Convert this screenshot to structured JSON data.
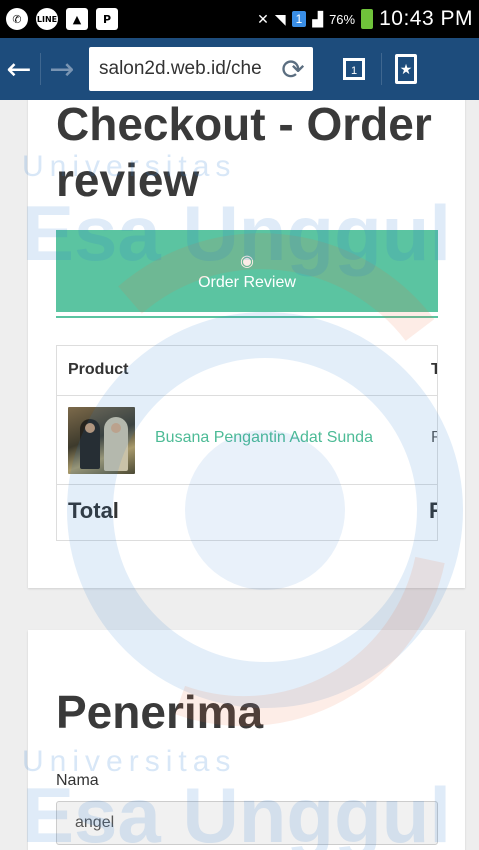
{
  "status_bar": {
    "icons": [
      "whatsapp-icon",
      "line-icon",
      "gallery-icon",
      "pinterest-icon",
      "nfc-icon",
      "wifi-icon",
      "sim-icon",
      "signal-icon"
    ],
    "battery_percent": "76%",
    "time": "10:43 PM"
  },
  "browser": {
    "url": "salon2d.web.id/che",
    "tabs_count": "1"
  },
  "checkout": {
    "title": "Checkout - Order review",
    "step_label": "Order Review",
    "table": {
      "header_product": "Product",
      "header_total": "T",
      "item_name": "Busana Pengantin Adat Sunda",
      "item_price": "R",
      "total_label": "Total",
      "total_value": "R"
    }
  },
  "penerima": {
    "title": "Penerima",
    "name_label": "Nama",
    "name_value": "angel"
  },
  "watermark": {
    "line_small": "Universitas",
    "line_large": "Esa Unggul"
  },
  "colors": {
    "accent": "#5bc4a1",
    "browser_bar": "#1d4c7c",
    "link": "#4dbb96"
  }
}
